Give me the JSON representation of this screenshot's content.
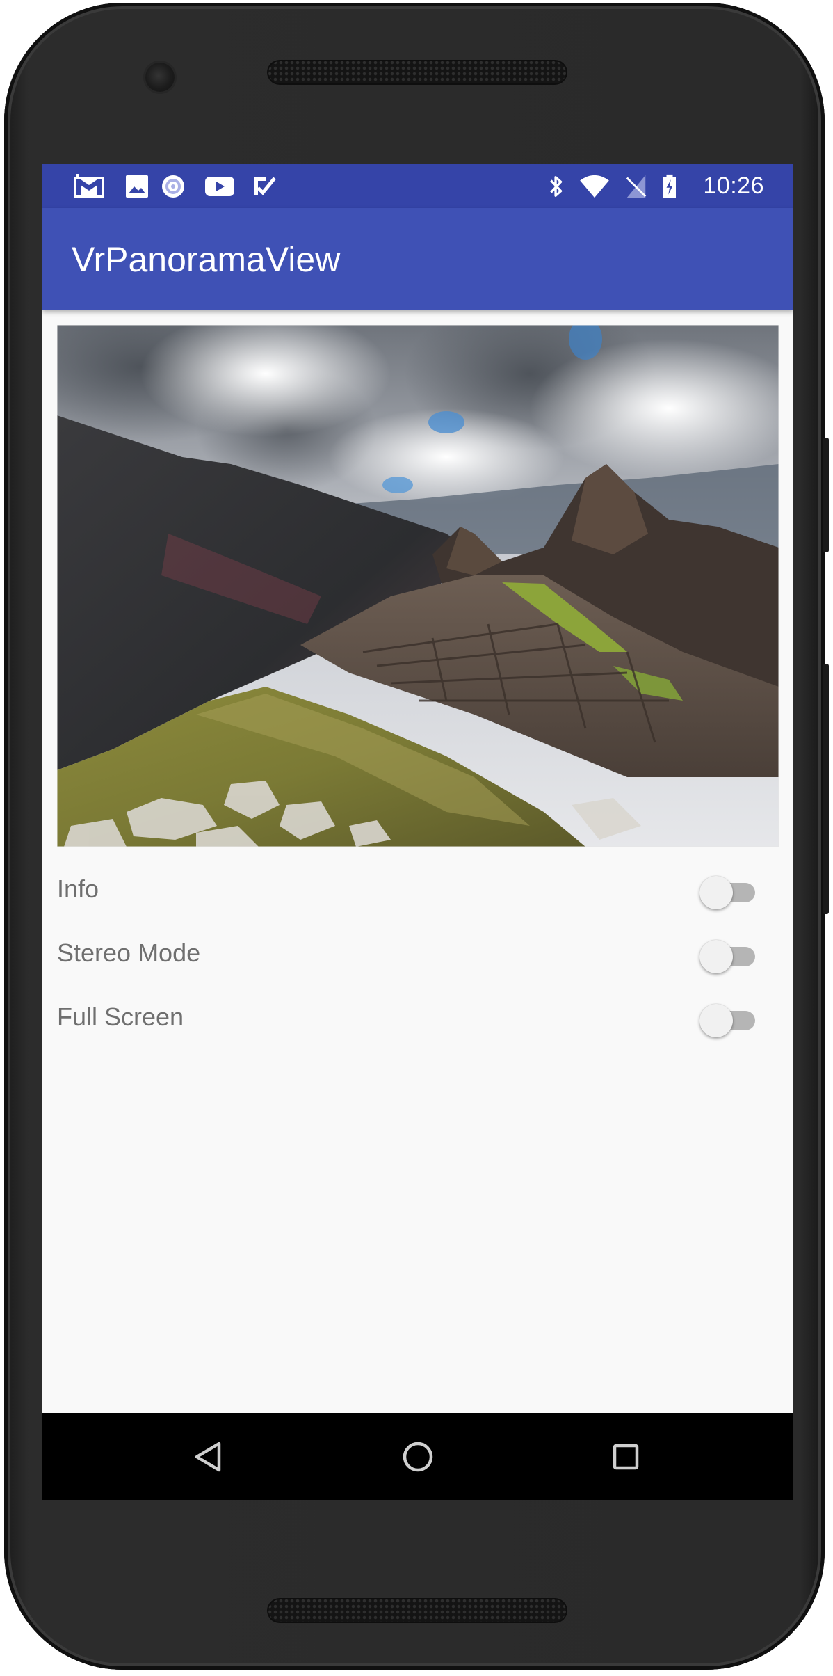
{
  "status_bar": {
    "time": "10:26",
    "left_icons": [
      "gmail-icon",
      "image-icon",
      "sync-icon",
      "youtube-icon",
      "task-check-icon"
    ],
    "right_icons": [
      "bluetooth-icon",
      "wifi-icon",
      "no-sim-icon",
      "battery-charging-icon"
    ],
    "color": "#3544a8"
  },
  "app_bar": {
    "title": "VrPanoramaView",
    "color": "#3f51b5"
  },
  "settings": [
    {
      "label": "Info",
      "enabled": false
    },
    {
      "label": "Stereo Mode",
      "enabled": false
    },
    {
      "label": "Full Screen",
      "enabled": false
    }
  ],
  "nav_bar": {
    "buttons": [
      "back-icon",
      "home-icon",
      "recents-icon"
    ]
  }
}
